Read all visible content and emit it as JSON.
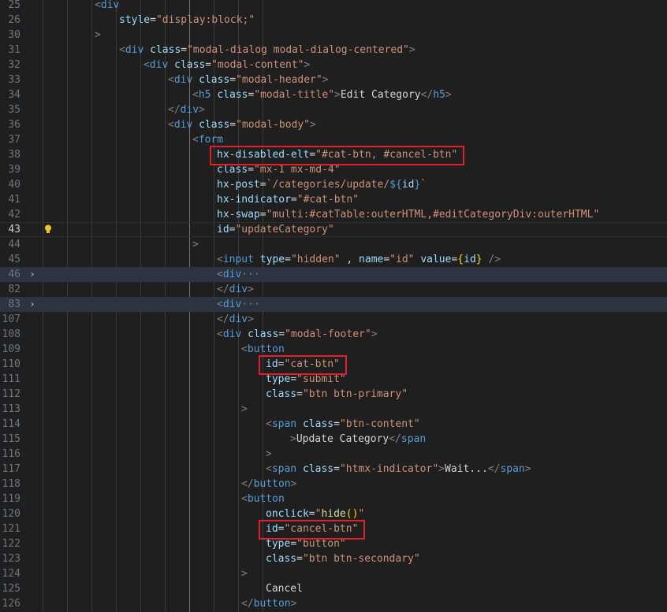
{
  "editor": {
    "language": "html",
    "colors": {
      "background": "#1f1f1f",
      "tag": "#569cd6",
      "attribute": "#9cdcfe",
      "string": "#ce9178",
      "text": "#d4d4d4",
      "highlight_box": "#e0202b"
    },
    "current_line": "43",
    "folded_lines": [
      "46",
      "83"
    ],
    "lightbulb_line": "43",
    "highlighted_boxes": [
      "38",
      "110",
      "121"
    ],
    "lines": [
      {
        "num": "25",
        "indent": 2,
        "tokens": [
          [
            "t-punc",
            "<"
          ],
          [
            "t-tag",
            "div"
          ]
        ]
      },
      {
        "num": "26",
        "indent": 3,
        "tokens": [
          [
            "t-attr",
            "style"
          ],
          [
            "t-txt",
            "="
          ],
          [
            "t-str",
            "\"display:block;\""
          ]
        ]
      },
      {
        "num": "30",
        "indent": 2,
        "tokens": [
          [
            "t-punc",
            ">"
          ]
        ]
      },
      {
        "num": "31",
        "indent": 3,
        "tokens": [
          [
            "t-punc",
            "<"
          ],
          [
            "t-tag",
            "div"
          ],
          [
            "t-txt",
            " "
          ],
          [
            "t-attr",
            "class"
          ],
          [
            "t-txt",
            "="
          ],
          [
            "t-str",
            "\"modal-dialog modal-dialog-centered\""
          ],
          [
            "t-punc",
            ">"
          ]
        ]
      },
      {
        "num": "32",
        "indent": 4,
        "tokens": [
          [
            "t-punc",
            "<"
          ],
          [
            "t-tag",
            "div"
          ],
          [
            "t-txt",
            " "
          ],
          [
            "t-attr",
            "class"
          ],
          [
            "t-txt",
            "="
          ],
          [
            "t-str",
            "\"modal-content\""
          ],
          [
            "t-punc",
            ">"
          ]
        ]
      },
      {
        "num": "33",
        "indent": 5,
        "tokens": [
          [
            "t-punc",
            "<"
          ],
          [
            "t-tag",
            "div"
          ],
          [
            "t-txt",
            " "
          ],
          [
            "t-attr",
            "class"
          ],
          [
            "t-txt",
            "="
          ],
          [
            "t-str",
            "\"modal-header\""
          ],
          [
            "t-punc",
            ">"
          ]
        ]
      },
      {
        "num": "34",
        "indent": 6,
        "tokens": [
          [
            "t-punc",
            "<"
          ],
          [
            "t-tag",
            "h5"
          ],
          [
            "t-txt",
            " "
          ],
          [
            "t-attr",
            "class"
          ],
          [
            "t-txt",
            "="
          ],
          [
            "t-str",
            "\"modal-title\""
          ],
          [
            "t-punc",
            ">"
          ],
          [
            "t-txt",
            "Edit Category"
          ],
          [
            "t-punc",
            "</"
          ],
          [
            "t-tag",
            "h5"
          ],
          [
            "t-punc",
            ">"
          ]
        ]
      },
      {
        "num": "35",
        "indent": 5,
        "tokens": [
          [
            "t-punc",
            "</"
          ],
          [
            "t-tag",
            "div"
          ],
          [
            "t-punc",
            ">"
          ]
        ]
      },
      {
        "num": "36",
        "indent": 5,
        "tokens": [
          [
            "t-punc",
            "<"
          ],
          [
            "t-tag",
            "div"
          ],
          [
            "t-txt",
            " "
          ],
          [
            "t-attr",
            "class"
          ],
          [
            "t-txt",
            "="
          ],
          [
            "t-str",
            "\"modal-body\""
          ],
          [
            "t-punc",
            ">"
          ]
        ]
      },
      {
        "num": "37",
        "indent": 6,
        "tokens": [
          [
            "t-punc",
            "<"
          ],
          [
            "t-tag",
            "form"
          ]
        ]
      },
      {
        "num": "38",
        "indent": 7,
        "tokens": [
          [
            "t-attr",
            "hx-disabled-elt"
          ],
          [
            "t-txt",
            "="
          ],
          [
            "t-str",
            "\"#cat-btn, #cancel-btn\""
          ]
        ]
      },
      {
        "num": "39",
        "indent": 7,
        "tokens": [
          [
            "t-attr",
            "class"
          ],
          [
            "t-txt",
            "="
          ],
          [
            "t-str",
            "\"mx-1 mx-md-4\""
          ]
        ]
      },
      {
        "num": "40",
        "indent": 7,
        "tokens": [
          [
            "t-attr",
            "hx-post"
          ],
          [
            "t-txt",
            "="
          ],
          [
            "t-str",
            "`/categories/update/"
          ],
          [
            "t-tag",
            "${"
          ],
          [
            "t-attr",
            "id"
          ],
          [
            "t-tag",
            "}"
          ],
          [
            "t-str",
            "`"
          ]
        ]
      },
      {
        "num": "41",
        "indent": 7,
        "tokens": [
          [
            "t-attr",
            "hx-indicator"
          ],
          [
            "t-txt",
            "="
          ],
          [
            "t-str",
            "\"#cat-btn\""
          ]
        ]
      },
      {
        "num": "42",
        "indent": 7,
        "tokens": [
          [
            "t-attr",
            "hx-swap"
          ],
          [
            "t-txt",
            "="
          ],
          [
            "t-str",
            "\"multi:#catTable:outerHTML,#editCategoryDiv:outerHTML\""
          ]
        ]
      },
      {
        "num": "43",
        "indent": 7,
        "tokens": [
          [
            "t-attr",
            "id"
          ],
          [
            "t-txt",
            "="
          ],
          [
            "t-str",
            "\"updateCategory\""
          ]
        ]
      },
      {
        "num": "44",
        "indent": 6,
        "tokens": [
          [
            "t-punc",
            ">"
          ]
        ]
      },
      {
        "num": "45",
        "indent": 7,
        "tokens": [
          [
            "t-punc",
            "<"
          ],
          [
            "t-tag",
            "input"
          ],
          [
            "t-txt",
            " "
          ],
          [
            "t-attr",
            "type"
          ],
          [
            "t-txt",
            "="
          ],
          [
            "t-str",
            "\"hidden\""
          ],
          [
            "t-txt",
            " , "
          ],
          [
            "t-attr",
            "name"
          ],
          [
            "t-txt",
            "="
          ],
          [
            "t-str",
            "\"id\""
          ],
          [
            "t-txt",
            " "
          ],
          [
            "t-attr",
            "value"
          ],
          [
            "t-txt",
            "="
          ],
          [
            "t-brace",
            "{"
          ],
          [
            "t-attr",
            "id"
          ],
          [
            "t-brace",
            "}"
          ],
          [
            "t-txt",
            " "
          ],
          [
            "t-punc",
            "/>"
          ]
        ]
      },
      {
        "num": "46",
        "indent": 7,
        "tokens": [
          [
            "t-punc",
            "<"
          ],
          [
            "t-tag",
            "div"
          ],
          [
            "t-fold",
            "···"
          ]
        ]
      },
      {
        "num": "82",
        "indent": 7,
        "tokens": [
          [
            "t-punc",
            "</"
          ],
          [
            "t-tag",
            "div"
          ],
          [
            "t-punc",
            ">"
          ]
        ]
      },
      {
        "num": "83",
        "indent": 7,
        "tokens": [
          [
            "t-punc",
            "<"
          ],
          [
            "t-tag",
            "div"
          ],
          [
            "t-fold",
            "···"
          ]
        ]
      },
      {
        "num": "107",
        "indent": 7,
        "tokens": [
          [
            "t-punc",
            "</"
          ],
          [
            "t-tag",
            "div"
          ],
          [
            "t-punc",
            ">"
          ]
        ]
      },
      {
        "num": "108",
        "indent": 7,
        "tokens": [
          [
            "t-punc",
            "<"
          ],
          [
            "t-tag",
            "div"
          ],
          [
            "t-txt",
            " "
          ],
          [
            "t-attr",
            "class"
          ],
          [
            "t-txt",
            "="
          ],
          [
            "t-str",
            "\"modal-footer\""
          ],
          [
            "t-punc",
            ">"
          ]
        ]
      },
      {
        "num": "109",
        "indent": 8,
        "tokens": [
          [
            "t-punc",
            "<"
          ],
          [
            "t-tag",
            "button"
          ]
        ]
      },
      {
        "num": "110",
        "indent": 9,
        "tokens": [
          [
            "t-attr",
            "id"
          ],
          [
            "t-txt",
            "="
          ],
          [
            "t-str",
            "\"cat-btn\""
          ]
        ]
      },
      {
        "num": "111",
        "indent": 9,
        "tokens": [
          [
            "t-attr",
            "type"
          ],
          [
            "t-txt",
            "="
          ],
          [
            "t-str",
            "\"submit\""
          ]
        ]
      },
      {
        "num": "112",
        "indent": 9,
        "tokens": [
          [
            "t-attr",
            "class"
          ],
          [
            "t-txt",
            "="
          ],
          [
            "t-str",
            "\"btn btn-primary\""
          ]
        ]
      },
      {
        "num": "113",
        "indent": 8,
        "tokens": [
          [
            "t-punc",
            ">"
          ]
        ]
      },
      {
        "num": "114",
        "indent": 9,
        "tokens": [
          [
            "t-punc",
            "<"
          ],
          [
            "t-tag",
            "span"
          ],
          [
            "t-txt",
            " "
          ],
          [
            "t-attr",
            "class"
          ],
          [
            "t-txt",
            "="
          ],
          [
            "t-str",
            "\"btn-content\""
          ]
        ]
      },
      {
        "num": "115",
        "indent": 10,
        "tokens": [
          [
            "t-punc",
            ">"
          ],
          [
            "t-txt",
            "Update Category"
          ],
          [
            "t-punc",
            "</"
          ],
          [
            "t-tag",
            "span"
          ]
        ]
      },
      {
        "num": "116",
        "indent": 9,
        "tokens": [
          [
            "t-punc",
            ">"
          ]
        ]
      },
      {
        "num": "117",
        "indent": 9,
        "tokens": [
          [
            "t-punc",
            "<"
          ],
          [
            "t-tag",
            "span"
          ],
          [
            "t-txt",
            " "
          ],
          [
            "t-attr",
            "class"
          ],
          [
            "t-txt",
            "="
          ],
          [
            "t-str",
            "\"htmx-indicator\""
          ],
          [
            "t-punc",
            ">"
          ],
          [
            "t-txt",
            "Wait..."
          ],
          [
            "t-punc",
            "</"
          ],
          [
            "t-tag",
            "span"
          ],
          [
            "t-punc",
            ">"
          ]
        ]
      },
      {
        "num": "118",
        "indent": 8,
        "tokens": [
          [
            "t-punc",
            "</"
          ],
          [
            "t-tag",
            "button"
          ],
          [
            "t-punc",
            ">"
          ]
        ]
      },
      {
        "num": "119",
        "indent": 8,
        "tokens": [
          [
            "t-punc",
            "<"
          ],
          [
            "t-tag",
            "button"
          ]
        ]
      },
      {
        "num": "120",
        "indent": 9,
        "tokens": [
          [
            "t-attr",
            "onclick"
          ],
          [
            "t-txt",
            "="
          ],
          [
            "t-str",
            "\""
          ],
          [
            "t-yel",
            "hide"
          ],
          [
            "t-brace",
            "()"
          ],
          [
            "t-str",
            "\""
          ]
        ]
      },
      {
        "num": "121",
        "indent": 9,
        "tokens": [
          [
            "t-attr",
            "id"
          ],
          [
            "t-txt",
            "="
          ],
          [
            "t-str",
            "\"cancel-btn\""
          ]
        ]
      },
      {
        "num": "122",
        "indent": 9,
        "tokens": [
          [
            "t-attr",
            "type"
          ],
          [
            "t-txt",
            "="
          ],
          [
            "t-str",
            "\"button\""
          ]
        ]
      },
      {
        "num": "123",
        "indent": 9,
        "tokens": [
          [
            "t-attr",
            "class"
          ],
          [
            "t-txt",
            "="
          ],
          [
            "t-str",
            "\"btn btn-secondary\""
          ]
        ]
      },
      {
        "num": "124",
        "indent": 8,
        "tokens": [
          [
            "t-punc",
            ">"
          ]
        ]
      },
      {
        "num": "125",
        "indent": 9,
        "tokens": [
          [
            "t-txt",
            "Cancel"
          ]
        ]
      },
      {
        "num": "126",
        "indent": 8,
        "tokens": [
          [
            "t-punc",
            "</"
          ],
          [
            "t-tag",
            "button"
          ],
          [
            "t-punc",
            ">"
          ]
        ]
      }
    ]
  }
}
